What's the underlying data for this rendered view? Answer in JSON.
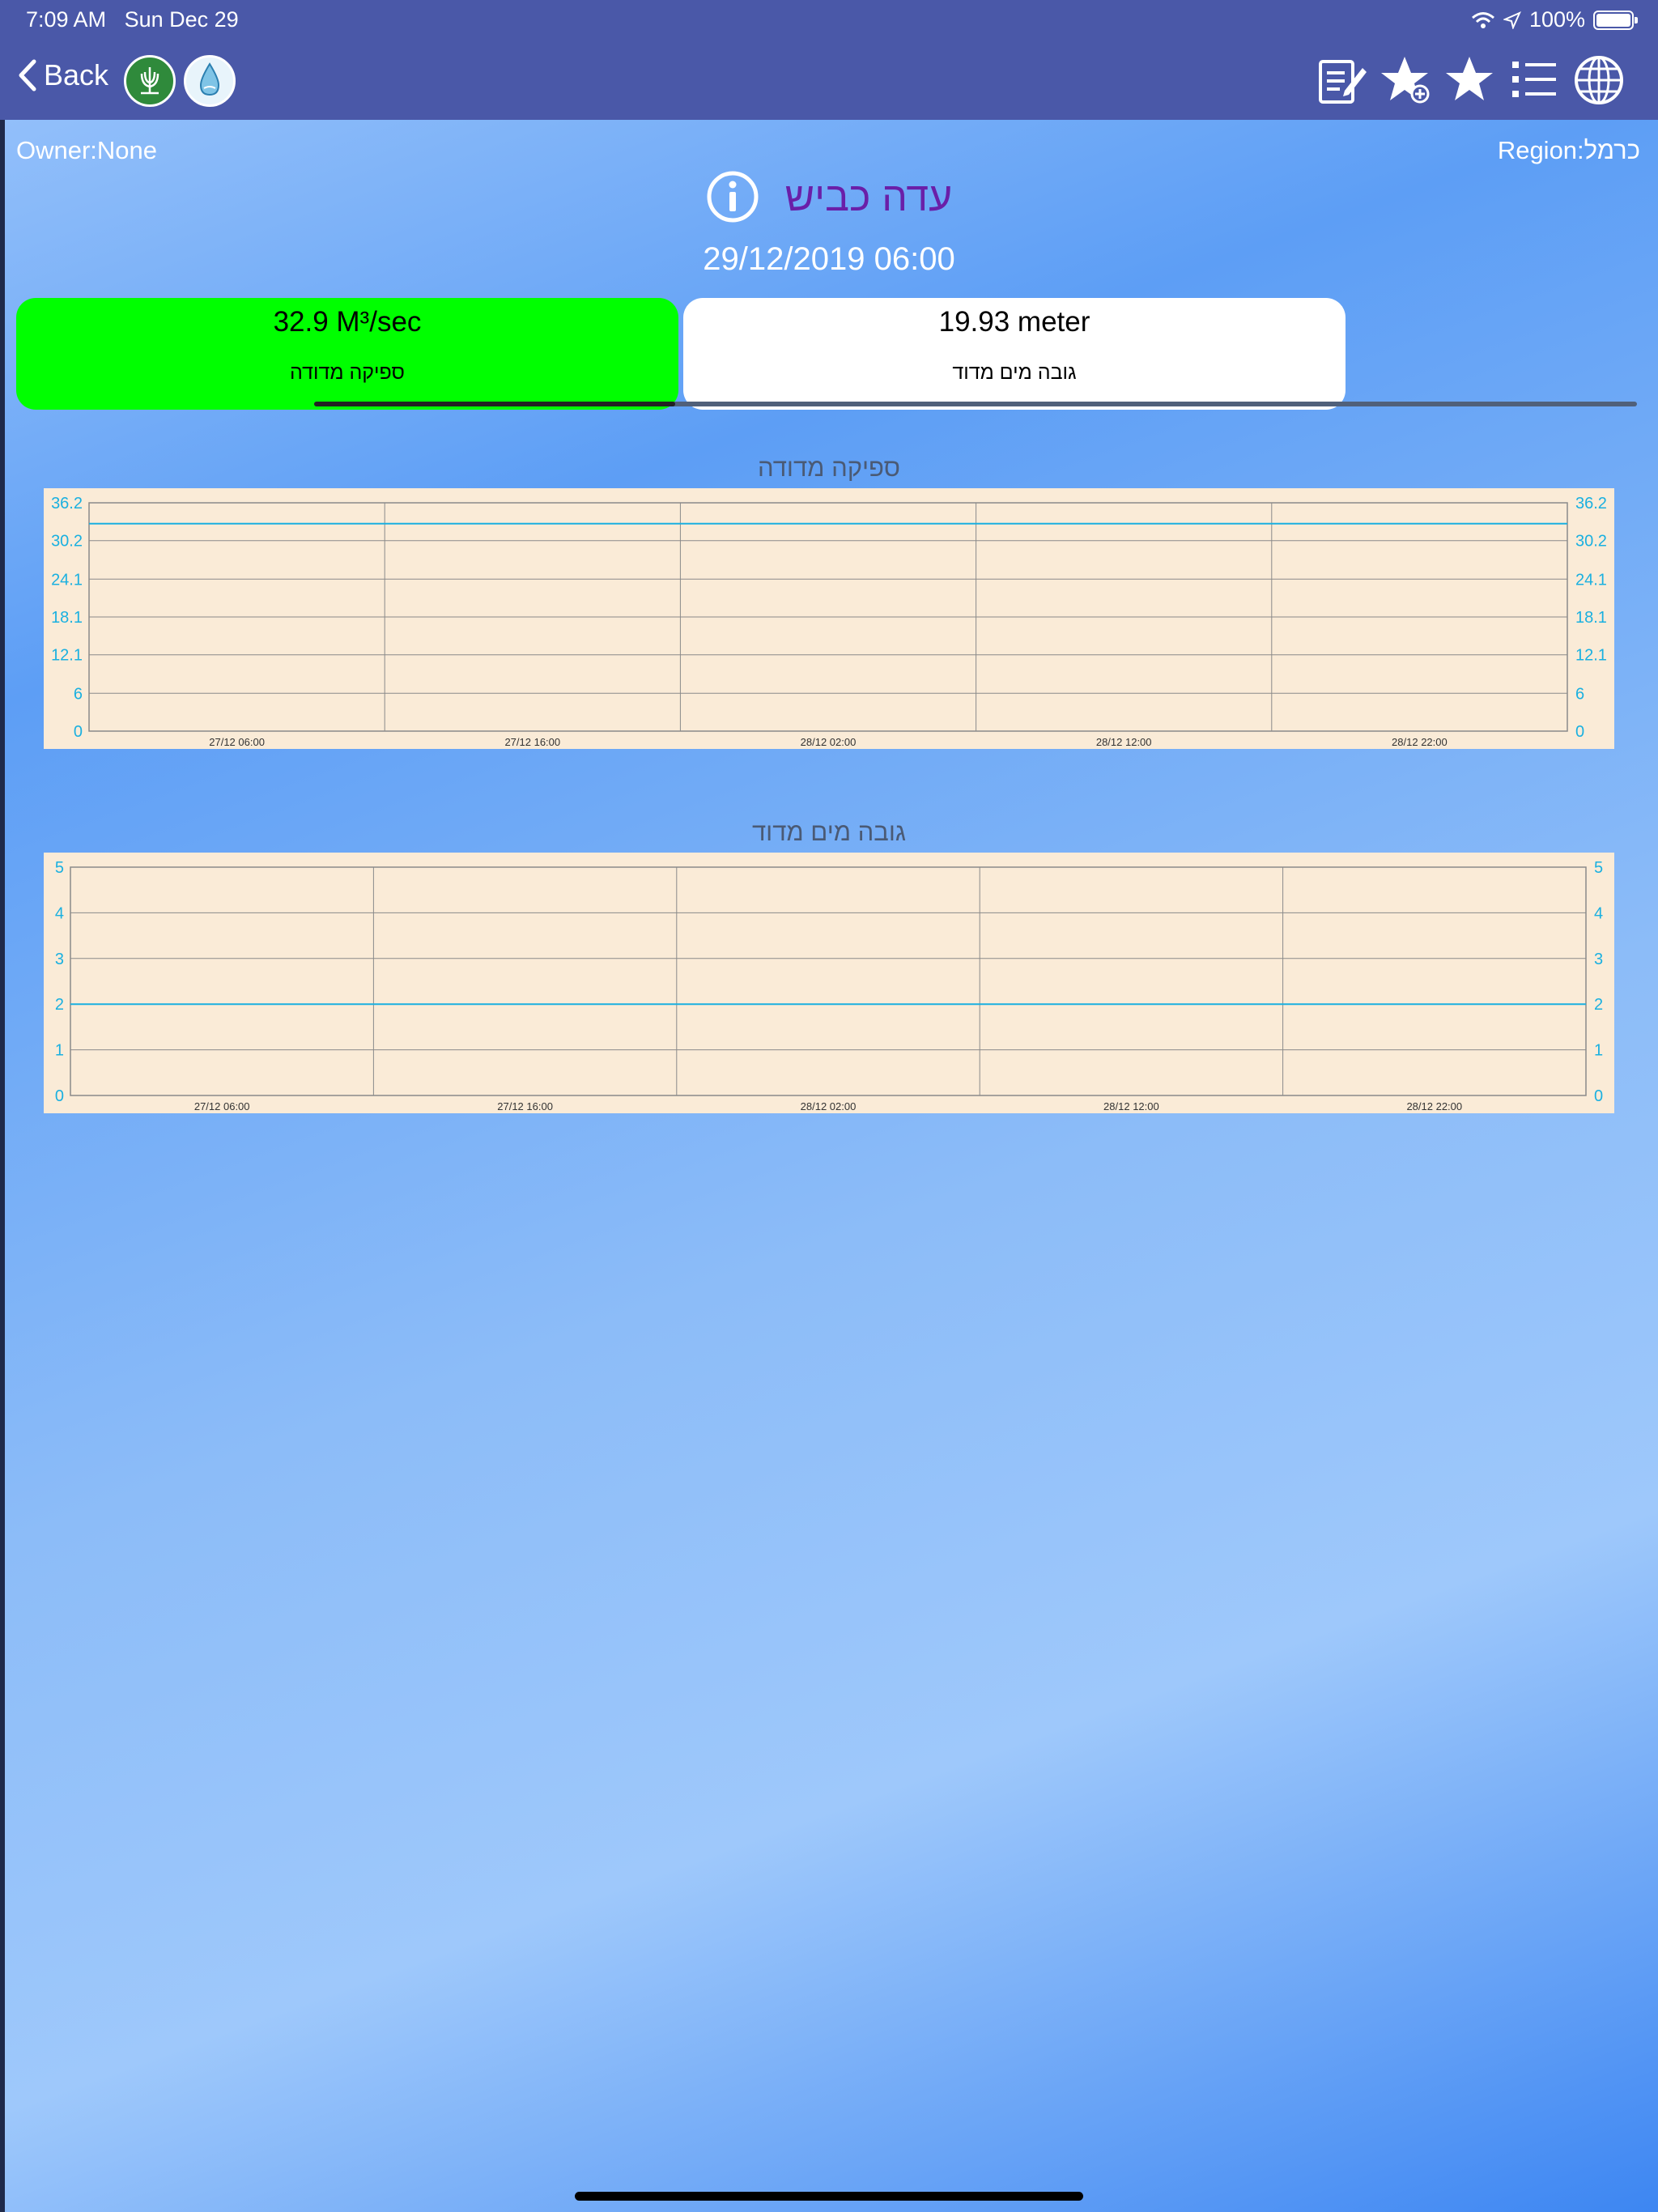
{
  "statusbar": {
    "time": "7:09 AM",
    "date": "Sun Dec 29",
    "battery": "100%"
  },
  "nav": {
    "back_label": "Back"
  },
  "station": {
    "owner": "Owner:None",
    "region": "Region:כרמל",
    "name": "עדה כביש",
    "datetime": "29/12/2019 06:00"
  },
  "cards": [
    {
      "value": "32.9 M³/sec",
      "label": "ספיקה מדודה",
      "color": "#00ff00"
    },
    {
      "value": "19.93 meter",
      "label": "גובה מים מדוד",
      "color": "#ffffff"
    }
  ],
  "colors": {
    "nav": "#4a58a8",
    "title": "#6a1fa8",
    "series": "#1ab0e0",
    "chart_bg": "#faebd7"
  },
  "chart_data": [
    {
      "type": "line",
      "title": "ספיקה מדודה",
      "x": [
        "27/12 06:00",
        "27/12 16:00",
        "28/12 02:00",
        "28/12 12:00",
        "28/12 22:00"
      ],
      "yticks": [
        "0",
        "6",
        "12.1",
        "18.1",
        "24.1",
        "30.2",
        "36.2"
      ],
      "ylim": [
        0,
        36.2
      ],
      "series": [
        {
          "values": [
            32.9,
            32.9,
            32.9,
            32.9,
            32.9,
            32.9
          ]
        }
      ],
      "grid": true
    },
    {
      "type": "line",
      "title": "גובה מים מדוד",
      "x": [
        "27/12 06:00",
        "27/12 16:00",
        "28/12 02:00",
        "28/12 12:00",
        "28/12 22:00"
      ],
      "yticks": [
        "0",
        "1",
        "2",
        "3",
        "4",
        "5"
      ],
      "ylim": [
        0,
        5
      ],
      "series": [
        {
          "values": [
            2,
            2,
            2,
            2,
            2,
            2
          ]
        }
      ],
      "grid": true
    }
  ]
}
